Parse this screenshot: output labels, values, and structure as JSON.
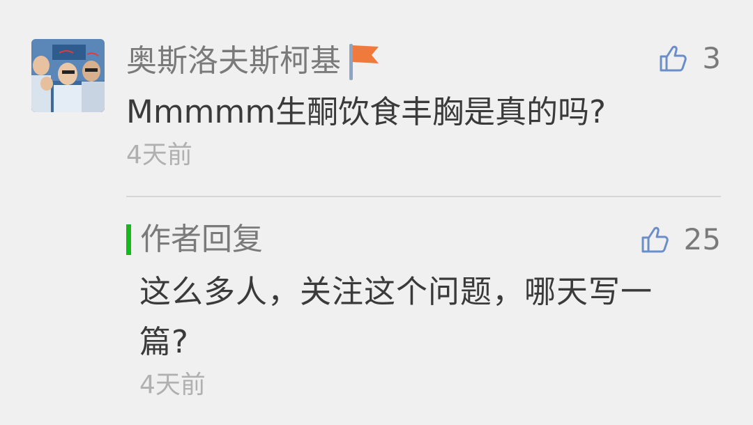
{
  "comment": {
    "username": "奥斯洛夫斯柯基",
    "badge_icon": "flag-icon",
    "badge_color": "#f07a3c",
    "likes": "3",
    "text": "Mmmmm生酮饮食丰胸是真的吗?",
    "time": "4天前"
  },
  "reply": {
    "label": "作者回复",
    "accent_color": "#17b81c",
    "likes": "25",
    "text": "这么多人，关注这个问题，哪天写一篇?",
    "time": "4天前"
  },
  "icons": {
    "like": "thumbs-up-icon",
    "like_color": "#6b8ec9"
  }
}
